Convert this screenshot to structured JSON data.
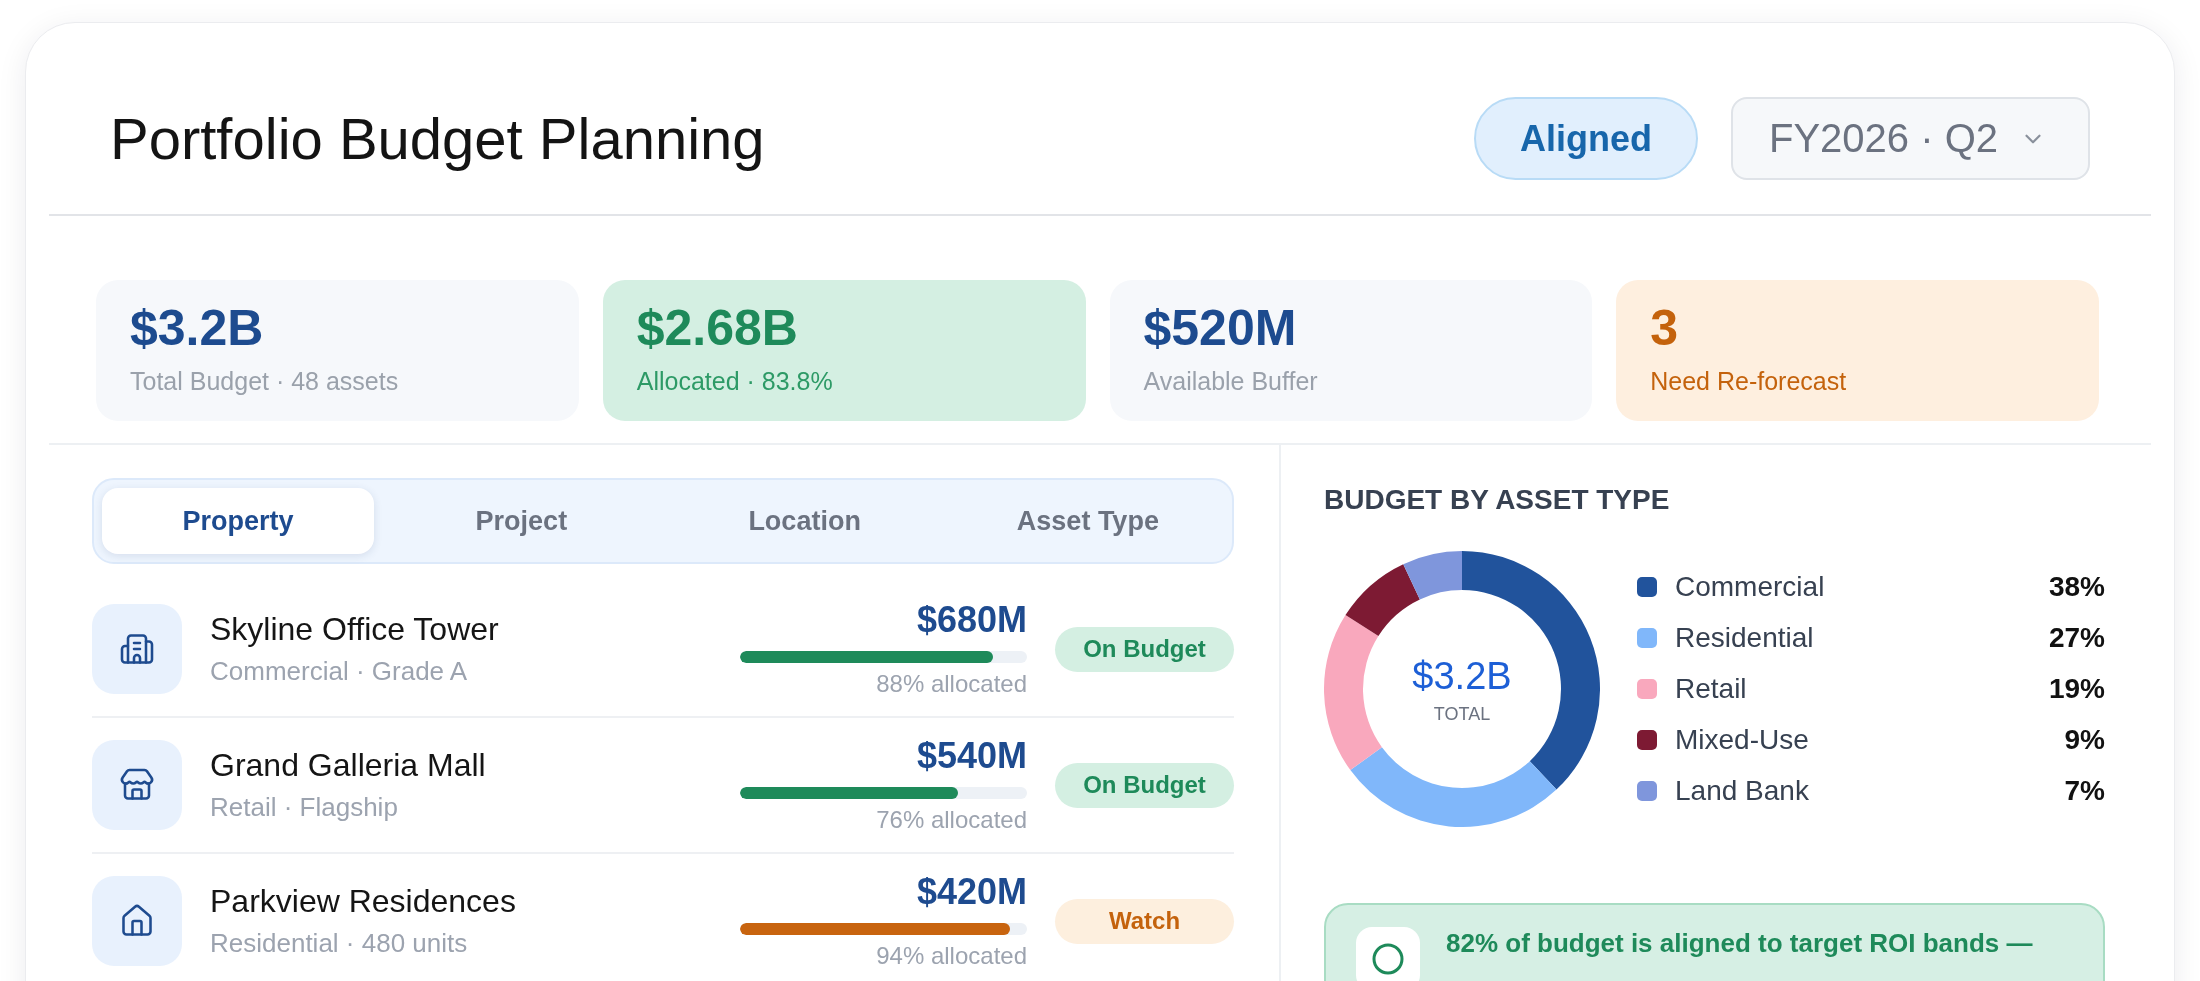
{
  "header": {
    "title": "Portfolio Budget Planning",
    "status": "Aligned",
    "period": "FY2026 · Q2"
  },
  "kpis": [
    {
      "value": "$3.2B",
      "label": "Total Budget · 48 assets",
      "kind": "neutral"
    },
    {
      "value": "$2.68B",
      "label": "Allocated · 83.8%",
      "kind": "positive"
    },
    {
      "value": "$520M",
      "label": "Available Buffer",
      "kind": "neutral"
    },
    {
      "value": "3",
      "label": "Need Re-forecast",
      "kind": "warning"
    }
  ],
  "tabs": [
    {
      "label": "Property",
      "selected": true
    },
    {
      "label": "Project",
      "selected": false
    },
    {
      "label": "Location",
      "selected": false
    },
    {
      "label": "Asset Type",
      "selected": false
    }
  ],
  "assets": [
    {
      "kind": "tower",
      "name": "Skyline Office Tower",
      "detail": "Commercial · Grade A",
      "amount": "$680M",
      "level": 0.88,
      "allocated": "88% allocated",
      "status": {
        "label": "On Budget",
        "kind": "good"
      }
    },
    {
      "kind": "mall",
      "name": "Grand Galleria Mall",
      "detail": "Retail · Flagship",
      "amount": "$540M",
      "level": 0.76,
      "allocated": "76% allocated",
      "status": {
        "label": "On Budget",
        "kind": "good"
      }
    },
    {
      "kind": "residence",
      "name": "Parkview Residences",
      "detail": "Residential · 480 units",
      "amount": "$420M",
      "level": 0.94,
      "allocated": "94% allocated",
      "status": {
        "label": "Watch",
        "kind": "watch"
      }
    }
  ],
  "breakdown": {
    "title": "BUDGET BY ASSET TYPE",
    "chart_data": {
      "type": "donut",
      "categories": [
        "Commercial",
        "Residential",
        "Retail",
        "Mixed-Use",
        "Land Bank"
      ],
      "values": [
        38,
        27,
        19,
        9,
        7
      ]
    },
    "center_value": "$3.2B",
    "center_label": "TOTAL",
    "legend": [
      {
        "share": "38%",
        "color": "#21539c"
      },
      {
        "share": "27%",
        "color": "#80b7fa"
      },
      {
        "share": "19%",
        "color": "#f9a8bd"
      },
      {
        "share": "9%",
        "color": "#7d1a33"
      },
      {
        "share": "7%",
        "color": "#7f96dc"
      }
    ]
  },
  "insight": {
    "text": "82% of budget is aligned to target ROI bands —"
  }
}
